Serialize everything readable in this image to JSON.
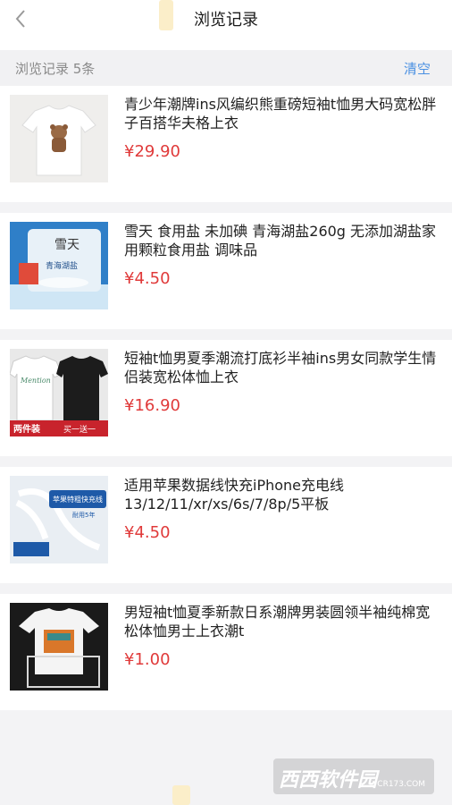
{
  "nav": {
    "title": "浏览记录"
  },
  "summary": {
    "count_label": "浏览记录 5条",
    "clear_label": "清空"
  },
  "items": [
    {
      "name": "青少年潮牌ins风编织熊重磅短袖t恤男大码宽松胖子百搭华夫格上衣",
      "price": "¥29.90"
    },
    {
      "name": "雪天 食用盐 未加碘 青海湖盐260g 无添加湖盐家用颗粒食用盐 调味品",
      "price": "¥4.50"
    },
    {
      "name": "短袖t恤男夏季潮流打底衫半袖ins男女同款学生情侣装宽松体恤上衣",
      "price": "¥16.90"
    },
    {
      "name": "适用苹果数据线快充iPhone充电线13/12/11/xr/xs/6s/7/8p/5平板",
      "price": "¥4.50"
    },
    {
      "name": "男短袖t恤夏季新款日系潮牌男装圆领半袖纯棉宽松体恤男士上衣潮t",
      "price": "¥1.00"
    }
  ],
  "thumb_text": {
    "salt_brand": "雪天",
    "salt_name": "青海湖盐",
    "tshirt_pack": "两件装",
    "tshirt_promo": "买一送一",
    "cable_title": "苹果特粗快充线",
    "cable_sub": "耐用5年"
  },
  "watermark": {
    "logo": "西西软件园",
    "site": "CR173.COM"
  },
  "colors": {
    "price": "#e03a3a",
    "accent": "#4a90e2"
  }
}
